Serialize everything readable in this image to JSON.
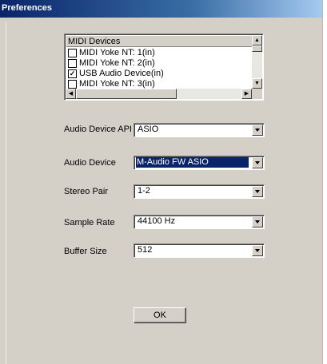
{
  "window": {
    "title": "Preferences"
  },
  "midi": {
    "header": "MIDI Devices",
    "items": [
      {
        "label": "MIDI Yoke NT:  1(in)",
        "checked": false
      },
      {
        "label": "MIDI Yoke NT:  2(in)",
        "checked": false
      },
      {
        "label": "USB Audio Device(in)",
        "checked": true
      },
      {
        "label": "MIDI Yoke NT:  3(in)",
        "checked": false
      }
    ]
  },
  "form": {
    "audio_device_api": {
      "label": "Audio Device API",
      "value": "ASIO"
    },
    "audio_device": {
      "label": "Audio Device",
      "value": "M-Audio FW ASIO"
    },
    "stereo_pair": {
      "label": "Stereo Pair",
      "value": "1-2"
    },
    "sample_rate": {
      "label": "Sample Rate",
      "value": "44100 Hz"
    },
    "buffer_size": {
      "label": "Buffer Size",
      "value": "512"
    }
  },
  "buttons": {
    "ok": "OK"
  }
}
